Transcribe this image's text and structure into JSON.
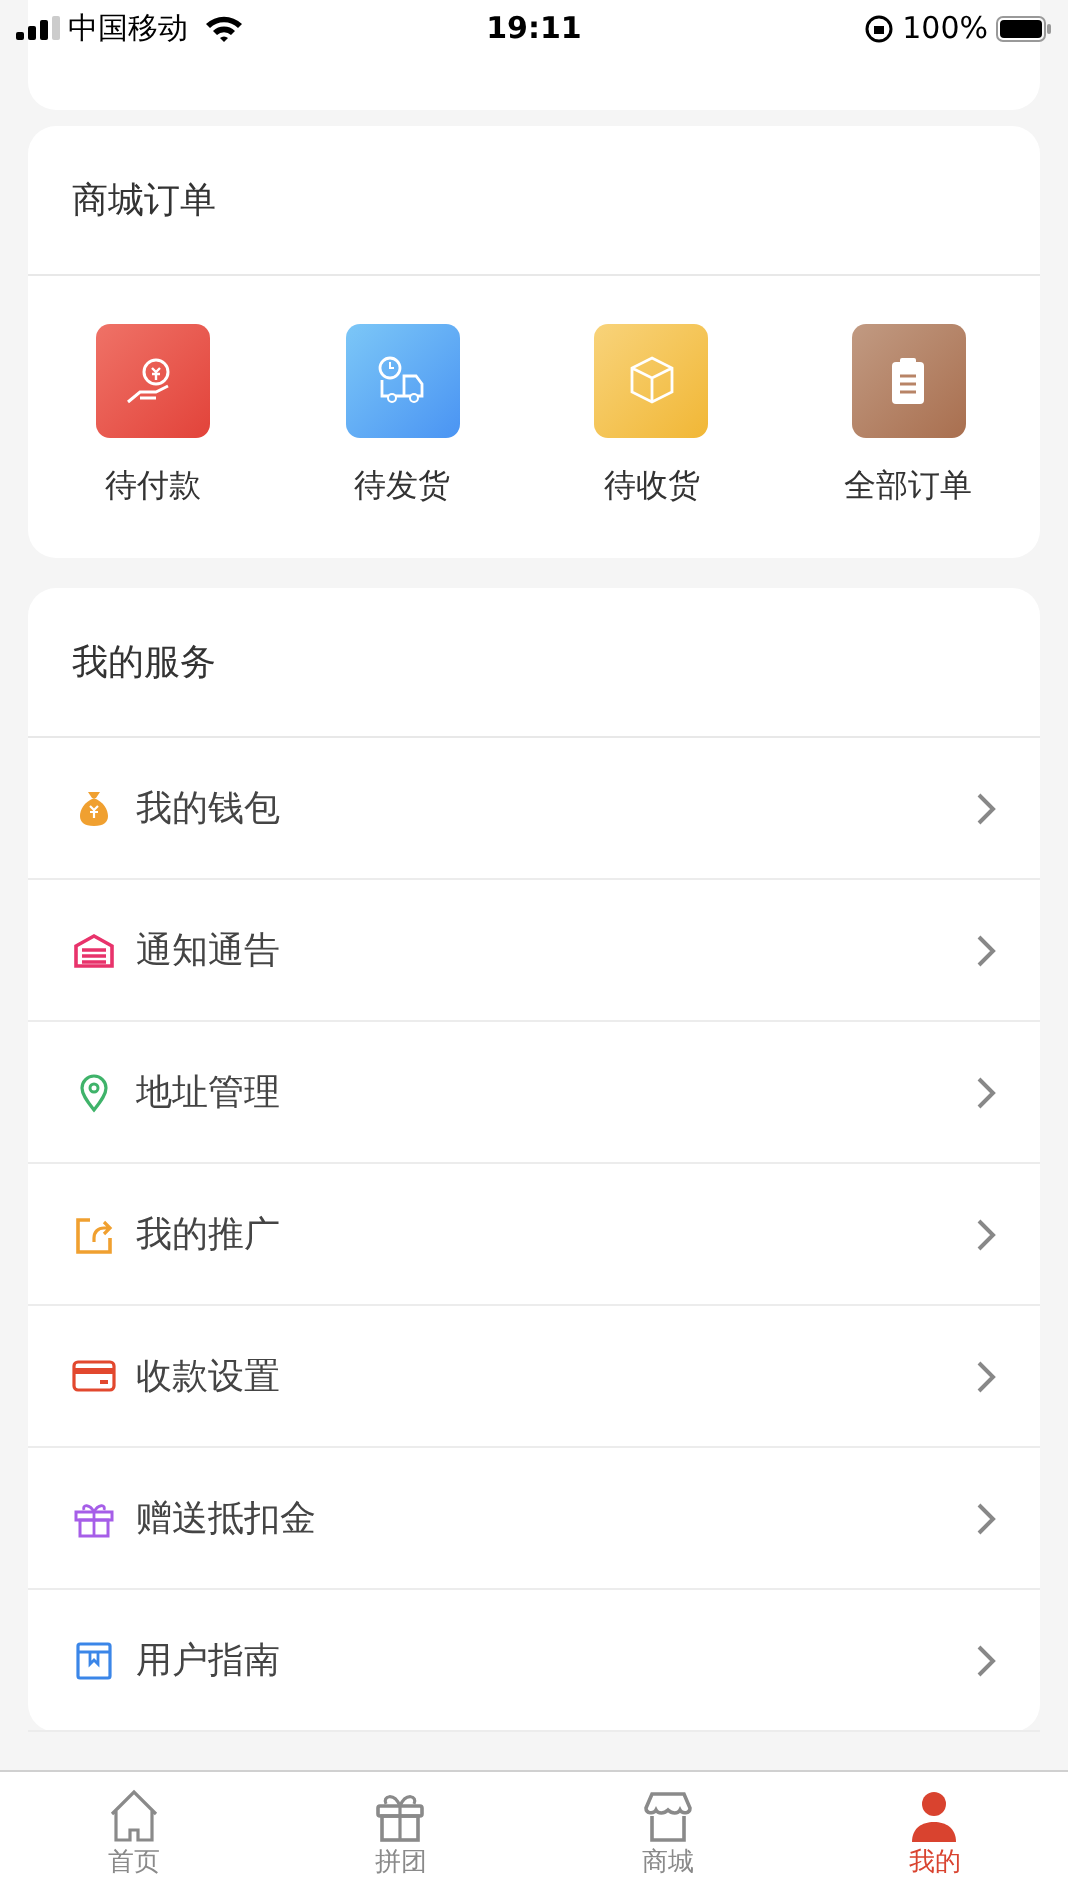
{
  "status_bar": {
    "carrier": "中国移动",
    "time": "19:11",
    "battery": "100%"
  },
  "orders": {
    "title": "商城订单",
    "items": [
      {
        "label": "待付款",
        "kind": "payment"
      },
      {
        "label": "待发货",
        "kind": "shipping"
      },
      {
        "label": "待收货",
        "kind": "receiving"
      },
      {
        "label": "全部订单",
        "kind": "all"
      }
    ]
  },
  "services": {
    "title": "我的服务",
    "items": [
      {
        "label": "我的钱包",
        "kind": "wallet"
      },
      {
        "label": "通知通告",
        "kind": "notice"
      },
      {
        "label": "地址管理",
        "kind": "address"
      },
      {
        "label": "我的推广",
        "kind": "share"
      },
      {
        "label": "收款设置",
        "kind": "card"
      },
      {
        "label": "赠送抵扣金",
        "kind": "gift"
      },
      {
        "label": "用户指南",
        "kind": "guide"
      }
    ]
  },
  "tab_bar": [
    {
      "label": "首页",
      "kind": "home",
      "selected": false
    },
    {
      "label": "拼团",
      "kind": "gift",
      "selected": false
    },
    {
      "label": "商城",
      "kind": "store",
      "selected": false
    },
    {
      "label": "我的",
      "kind": "user",
      "selected": true
    }
  ]
}
